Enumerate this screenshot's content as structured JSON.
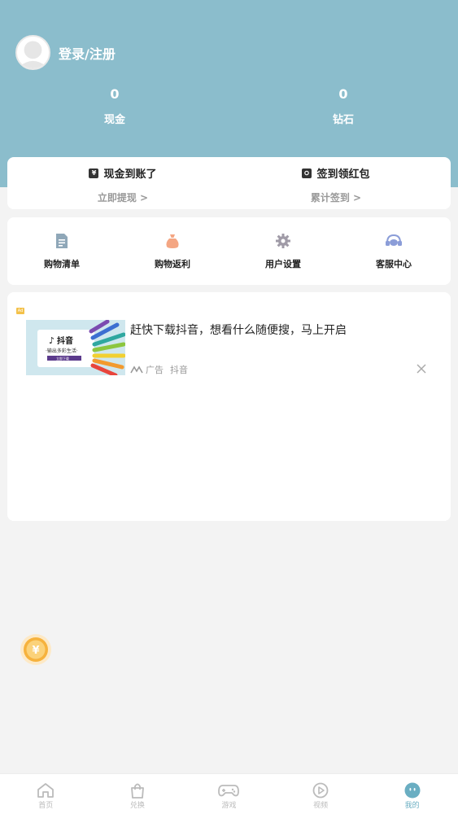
{
  "header": {
    "login_label": "登录/注册",
    "stats": [
      {
        "value": "0",
        "label": "现金"
      },
      {
        "value": "0",
        "label": "钻石"
      }
    ]
  },
  "rewards": {
    "cash": {
      "icon": "yen-icon",
      "title": "现金到账了",
      "sub": "立即提现 >"
    },
    "sign": {
      "icon": "checkin-icon",
      "title": "签到领红包",
      "sub": "累计签到 >"
    }
  },
  "menu": [
    {
      "icon": "document-icon",
      "label": "购物清单"
    },
    {
      "icon": "money-bag-icon",
      "label": "购物返利"
    },
    {
      "icon": "gear-icon",
      "label": "用户设置"
    },
    {
      "icon": "headset-icon",
      "label": "客服中心"
    }
  ],
  "ad": {
    "badge": "Ad",
    "title": "赶快下载抖音，想看什么随便搜，马上开启",
    "meta_tag": "广告",
    "meta_source": "抖音",
    "thumb_brand": "抖音",
    "thumb_slogan": "·输出多彩生活·",
    "thumb_button": "立即下载"
  },
  "tabs": [
    {
      "icon": "home-icon",
      "label": "首页",
      "active": false
    },
    {
      "icon": "bag-icon",
      "label": "兑换",
      "active": false
    },
    {
      "icon": "gamepad-icon",
      "label": "游戏",
      "active": false
    },
    {
      "icon": "play-icon",
      "label": "视频",
      "active": false
    },
    {
      "icon": "profile-icon",
      "label": "我的",
      "active": true
    }
  ],
  "colors": {
    "header_bg": "#8bbdcc",
    "active_tab": "#6aaec2",
    "page_bg": "#f3f3f3"
  }
}
